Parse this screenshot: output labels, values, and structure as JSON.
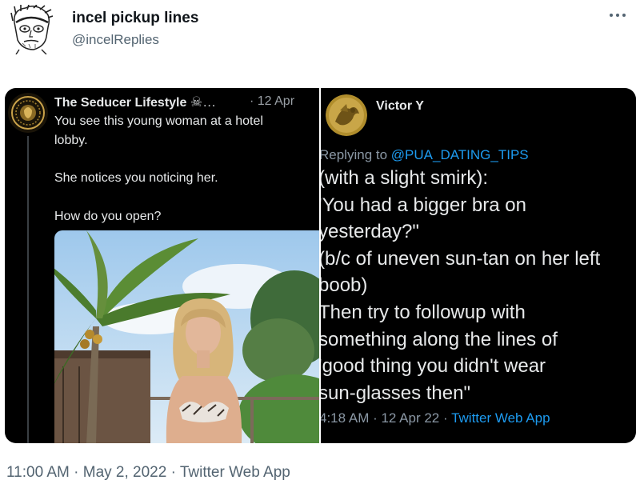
{
  "tweet": {
    "author_name": "incel pickup lines",
    "author_handle": "@incelReplies",
    "meta": "11:00 AM · May 2, 2022 · Twitter Web App"
  },
  "left_panel": {
    "name": "The Seducer Lifestyle",
    "name_suffix": "☠…",
    "date": "· 12 Apr",
    "lines": [
      "You see this young woman at a hotel",
      "lobby.",
      "She notices you noticing her.",
      "How do you open?"
    ]
  },
  "right_panel": {
    "name": "Victor Y",
    "replying_prefix": "Replying to ",
    "replying_handle": "@PUA_DATING_TIPS",
    "body_lines": [
      "(with a slight smirk):",
      "'You had a bigger bra on",
      "yesterday?\"",
      "(b/c of uneven sun-tan on her left",
      "boob)",
      "Then try to followup with",
      "something along the lines of",
      "'good thing you didn't wear",
      "sun-glasses then\""
    ],
    "footer_time": "4:18 AM · 12 Apr 22 · ",
    "footer_source": "Twitter Web App"
  },
  "colors": {
    "link": "#1d9bf0",
    "secondary_text": "#536471",
    "panel_bg": "#000000"
  },
  "icons": {
    "more": "more-horizontal-icon",
    "skull": "skull-crossbones-icon"
  }
}
